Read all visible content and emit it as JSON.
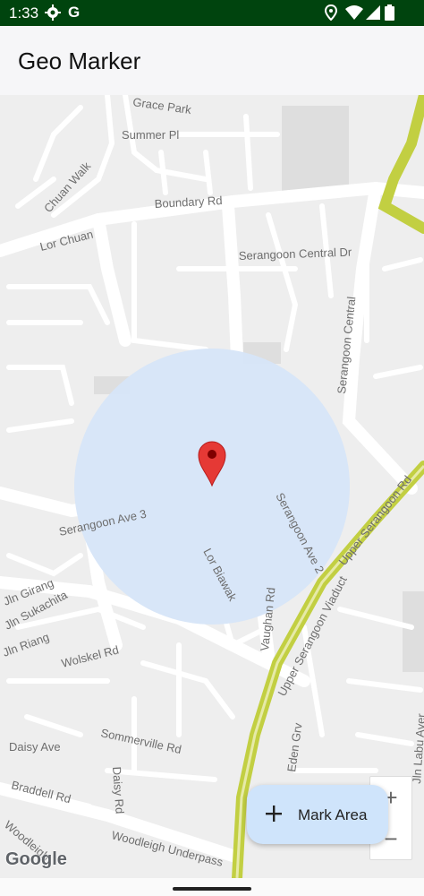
{
  "status_bar": {
    "time": "1:33",
    "icons": [
      "settings-icon",
      "google-icon",
      "location-icon",
      "wifi-icon",
      "signal-icon",
      "battery-icon"
    ],
    "google_letter": "G"
  },
  "app_bar": {
    "title": "Geo Marker"
  },
  "map": {
    "road_labels": {
      "grace_park": "Grace Park",
      "summer_pl": "Summer Pl",
      "chuan_walk": "Chuan Walk",
      "boundary_rd": "Boundary Rd",
      "lor_chuan": "Lor Chuan",
      "serangoon_central_dr": "Serangoon Central Dr",
      "serangoon_central": "Serangoon Central",
      "serangoon_ave_3": "Serangoon Ave 3",
      "serangoon_ave_2": "Serangoon Ave 2",
      "lor_biawak": "Lor Biawak",
      "vaughan_rd": "Vaughan Rd",
      "upper_serangoon_rd": "Upper Serangoon Rd",
      "upper_serangoon_viaduct": "Upper Serangoon Viaduct",
      "jln_girang": "Jln Girang",
      "jln_sukachita": "Jln Sukachita",
      "jln_riang": "Jln Riang",
      "wolskel_rd": "Wolskel Rd",
      "sommerville_rd": "Sommerville Rd",
      "daisy_ave": "Daisy Ave",
      "daisy_rd": "Daisy Rd",
      "eden_grv": "Eden Grv",
      "jln_labu_ayer": "Jln Labu Ayer",
      "braddell_rd": "Braddell Rd",
      "woodleigh_underpass": "Woodleigh Underpass",
      "woodleigh": "Woodleigh"
    },
    "marker_icon": "map-pin-icon",
    "geofence_color": "#d6e5f8",
    "marker_color": "#e53935",
    "expressway_color": "#c2cf42"
  },
  "fab": {
    "label": "Mark Area",
    "icon": "plus-icon",
    "background": "#cfe4fb"
  },
  "zoom": {
    "in_label": "+",
    "out_label": "−"
  },
  "attribution": {
    "logo_text": "Google"
  }
}
